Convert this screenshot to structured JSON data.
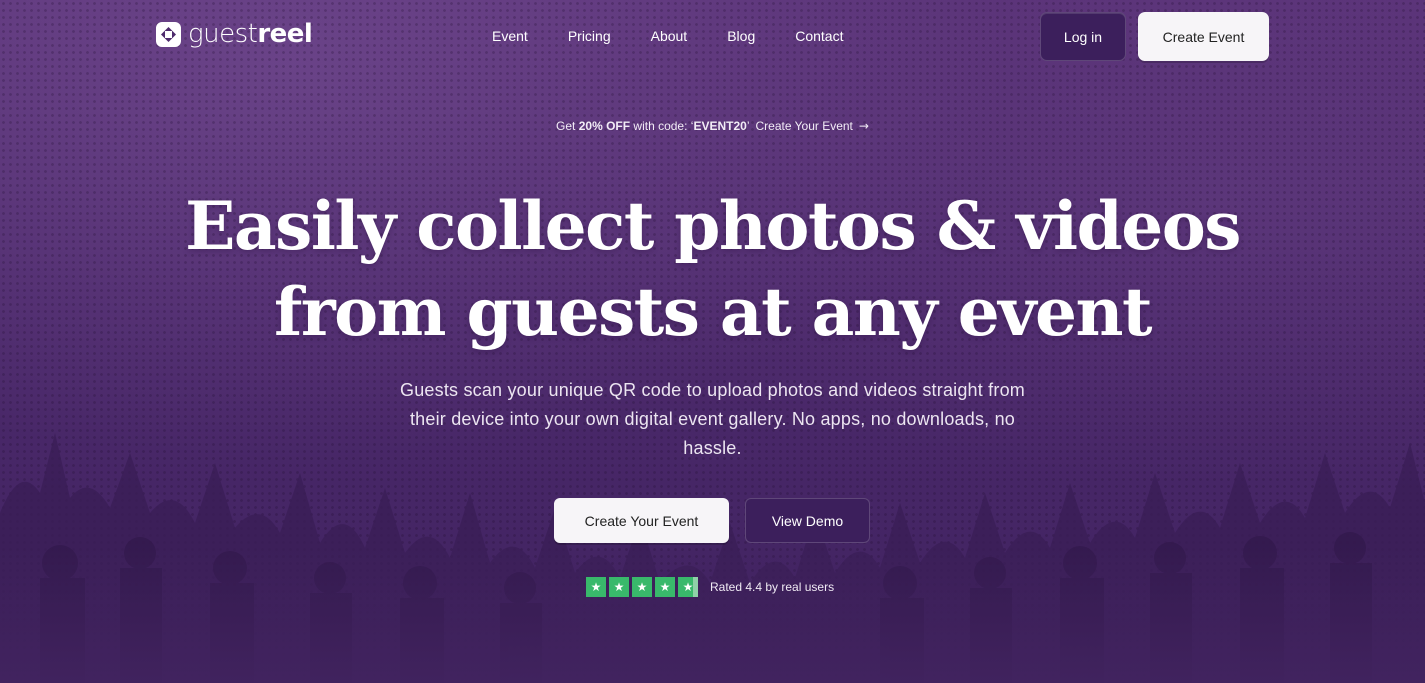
{
  "brand": {
    "logo_light": "guest",
    "logo_bold": "reel"
  },
  "nav": {
    "links": [
      "Event",
      "Pricing",
      "About",
      "Blog",
      "Contact"
    ],
    "login_label": "Log in",
    "create_label": "Create Event"
  },
  "promo": {
    "prefix": "Get ",
    "discount": "20% OFF",
    "middle": " with code: ‘",
    "code": "EVENT20",
    "suffix": "’",
    "cta": "Create Your Event",
    "arrow": "→"
  },
  "hero": {
    "headline_line1": "Easily collect photos & videos",
    "headline_line2": "from guests at any event",
    "subtitle": "Guests scan your unique QR code to upload photos and videos straight from their device into your own digital event gallery. No apps, no downloads, no hassle.",
    "primary_button": "Create Your Event",
    "secondary_button": "View Demo"
  },
  "rating": {
    "stars": [
      "★",
      "★",
      "★",
      "★",
      "★"
    ],
    "score": 4.4,
    "text": "Rated 4.4 by real users"
  },
  "colors": {
    "background": "#4d2a6c",
    "button_dark": "#3c1f5c",
    "button_light": "#f7f5f8",
    "star_green": "#39b96b"
  }
}
